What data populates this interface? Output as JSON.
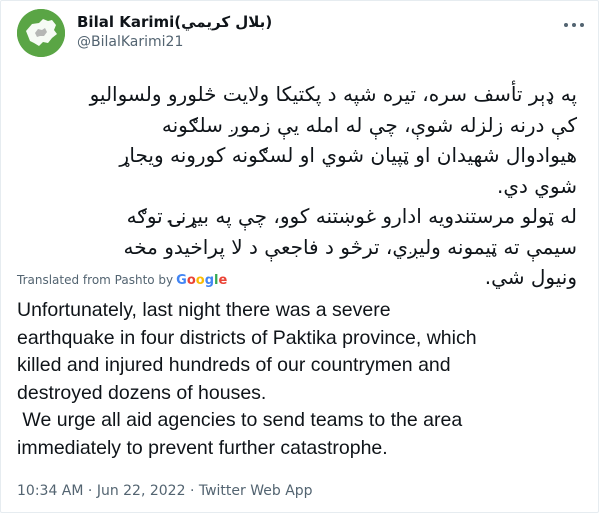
{
  "tweet": {
    "display_name": "Bilal Karimi(بلال کریمي)",
    "handle": "@BilalKarimi21",
    "original_lines": [
      "په ډېر تأسف سره، تیره شپه د پکتیکا ولایت څلورو ولسوالیو",
      "کې درنه زلزله شوې، چې له امله يې زموږ سلګونه",
      "هیوادوال شهیدان او ټپیان شوي او لسګونه کورونه ویجاړ",
      "شوي دي.",
      "له ټولو مرستندویه ادارو غوښتنه کوو، چې په بیړنۍ توګه",
      "سیمې ته ټیمونه ولیږي، ترڅو د فاجعې د لا پراخیدو مخه",
      "ونیول شي."
    ],
    "translated_from_label": "Translated from Pashto by",
    "google_brand": "Google",
    "translation_lines": [
      "Unfortunately, last night there was a severe",
      "earthquake in four districts of Paktika province, which",
      "killed and injured hundreds of our countrymen and",
      "destroyed dozens of houses.",
      " We urge all aid agencies to send teams to the area",
      "immediately to prevent further catastrophe."
    ],
    "time": "10:34 AM",
    "separator": "·",
    "date": "Jun 22, 2022",
    "source": "Twitter Web App"
  },
  "colors": {
    "text": "#0f1419",
    "secondary": "#536471",
    "avatar_bg": "#5aa545",
    "border": "#e6ecf0"
  },
  "icons": {
    "more": "more-horizontal-icon"
  }
}
